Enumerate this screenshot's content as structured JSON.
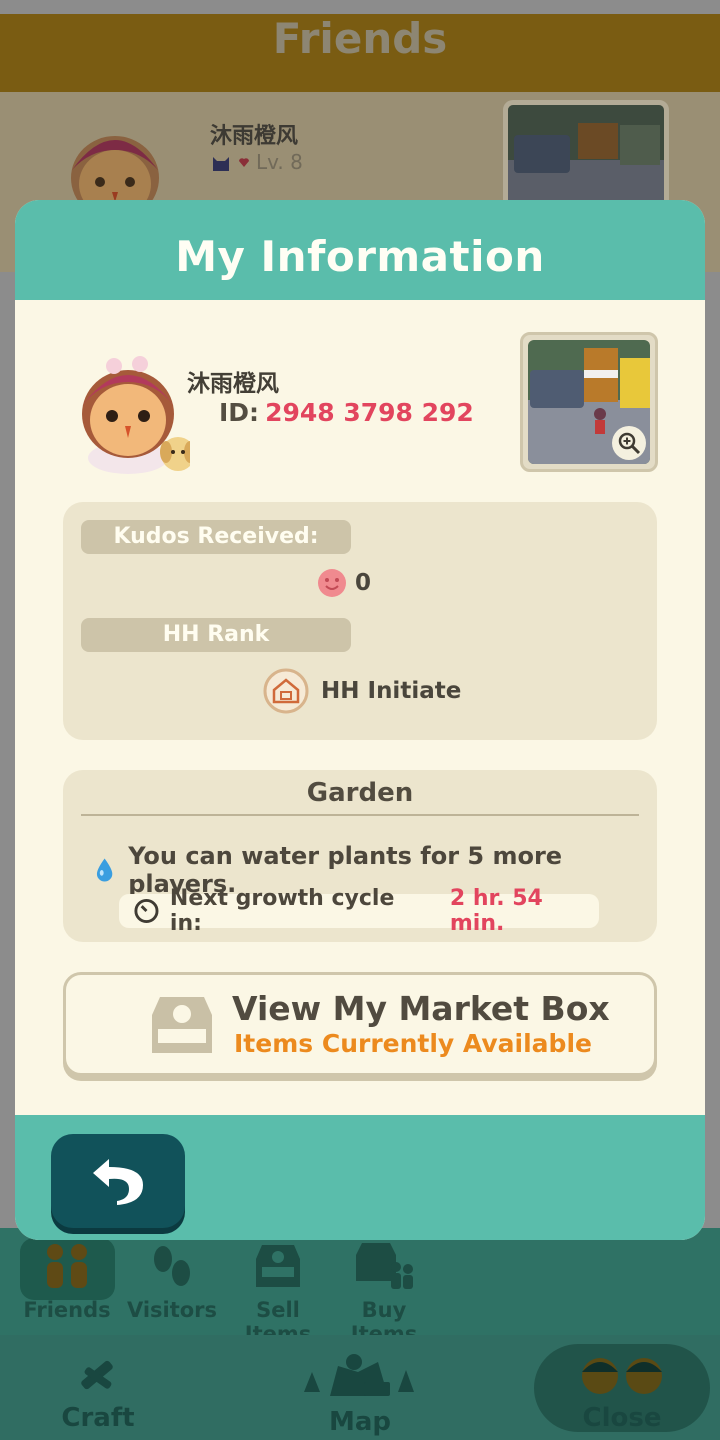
{
  "background": {
    "header_title": "Friends",
    "friend": {
      "name": "沐雨橙风",
      "level": "Lv. 8"
    }
  },
  "tabs": [
    {
      "label": "Friends",
      "icon": "friends-icon",
      "active": true
    },
    {
      "label": "Visitors",
      "icon": "footprints-icon",
      "active": false
    },
    {
      "label": "Sell Items",
      "icon": "sell-box-icon",
      "active": false
    },
    {
      "label": "Buy Items",
      "icon": "buy-box-icon",
      "active": false
    }
  ],
  "bottom_nav": [
    {
      "label": "Craft",
      "icon": "craft-icon"
    },
    {
      "label": "Map",
      "icon": "map-icon"
    },
    {
      "label": "Close",
      "icon": "villagers-icon"
    }
  ],
  "modal": {
    "title": "My Information",
    "name": "沐雨橙风",
    "id_label": "ID:",
    "id_value": "2948 3798 292",
    "kudos_label": "Kudos Received:",
    "kudos_value": "0",
    "rank_label": "HH Rank",
    "rank_value": "HH Initiate",
    "garden": {
      "title": "Garden",
      "water_text": "You can water plants for 5 more players.",
      "growth_label": "Next growth cycle in:",
      "growth_value": "2 hr. 54 min."
    },
    "market": {
      "title": "View My Market Box",
      "subtitle": "Items Currently Available"
    }
  },
  "colors": {
    "teal": "#5abdab",
    "cream": "#fbf7e5",
    "accent_red": "#e2455e",
    "accent_orange": "#ec8a1e",
    "dark_teal_button": "#11525a"
  }
}
